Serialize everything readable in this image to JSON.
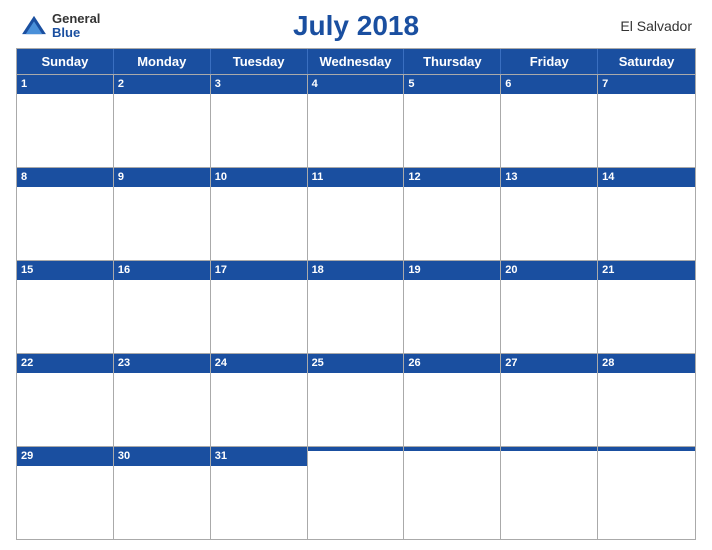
{
  "logo": {
    "general": "General",
    "blue": "Blue"
  },
  "header": {
    "title": "July 2018",
    "country": "El Salvador"
  },
  "weekdays": [
    "Sunday",
    "Monday",
    "Tuesday",
    "Wednesday",
    "Thursday",
    "Friday",
    "Saturday"
  ],
  "weeks": [
    [
      1,
      2,
      3,
      4,
      5,
      6,
      7
    ],
    [
      8,
      9,
      10,
      11,
      12,
      13,
      14
    ],
    [
      15,
      16,
      17,
      18,
      19,
      20,
      21
    ],
    [
      22,
      23,
      24,
      25,
      26,
      27,
      28
    ],
    [
      29,
      30,
      31,
      null,
      null,
      null,
      null
    ]
  ],
  "colors": {
    "blue": "#1a4fa0"
  }
}
